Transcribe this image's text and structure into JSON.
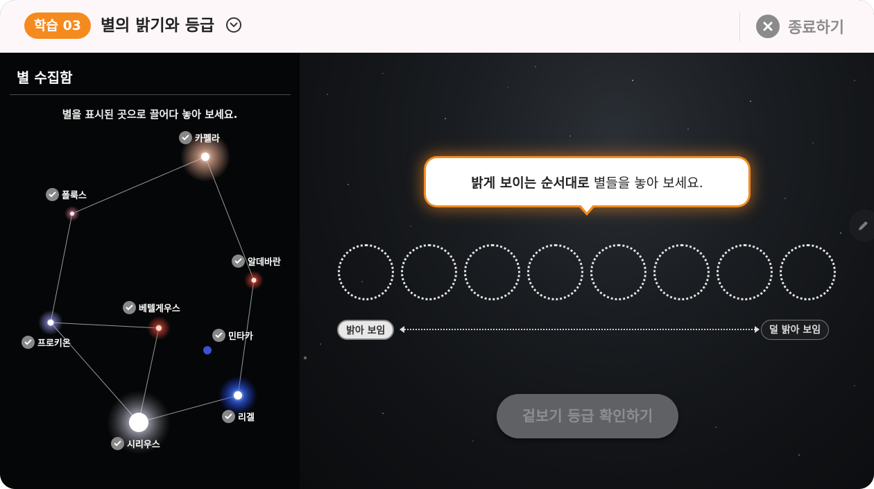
{
  "header": {
    "lesson_badge": "학습 03",
    "title": "별의 밝기와 등급",
    "close_label": "종료하기"
  },
  "panel": {
    "title": "별 수집함",
    "instruction": "별을 표시된 곳으로 끌어다 놓아 보세요.",
    "stars": [
      {
        "name": "카펠라",
        "color": "#f4c8b4"
      },
      {
        "name": "폴룩스",
        "color": "#d9a0ad"
      },
      {
        "name": "알데바란",
        "color": "#f09a84"
      },
      {
        "name": "베텔게우스",
        "color": "#ef5a4c"
      },
      {
        "name": "민타카",
        "color": "#4b5ad8"
      },
      {
        "name": "프로키온",
        "color": "#c8c8f5"
      },
      {
        "name": "리겔",
        "color": "#6aa0ff"
      },
      {
        "name": "시리우스",
        "color": "#ffffff"
      }
    ]
  },
  "main": {
    "bubble_bold": "밝게 보이는 순서대로",
    "bubble_rest": " 별들을 놓아 보세요.",
    "slots": 8,
    "scale_bright": "밝아 보임",
    "scale_dim": "덜 밝아 보임",
    "confirm_label": "겉보기 등급 확인하기"
  },
  "colors": {
    "accent": "#f58a1f",
    "close_gray": "#8b8b8b"
  }
}
